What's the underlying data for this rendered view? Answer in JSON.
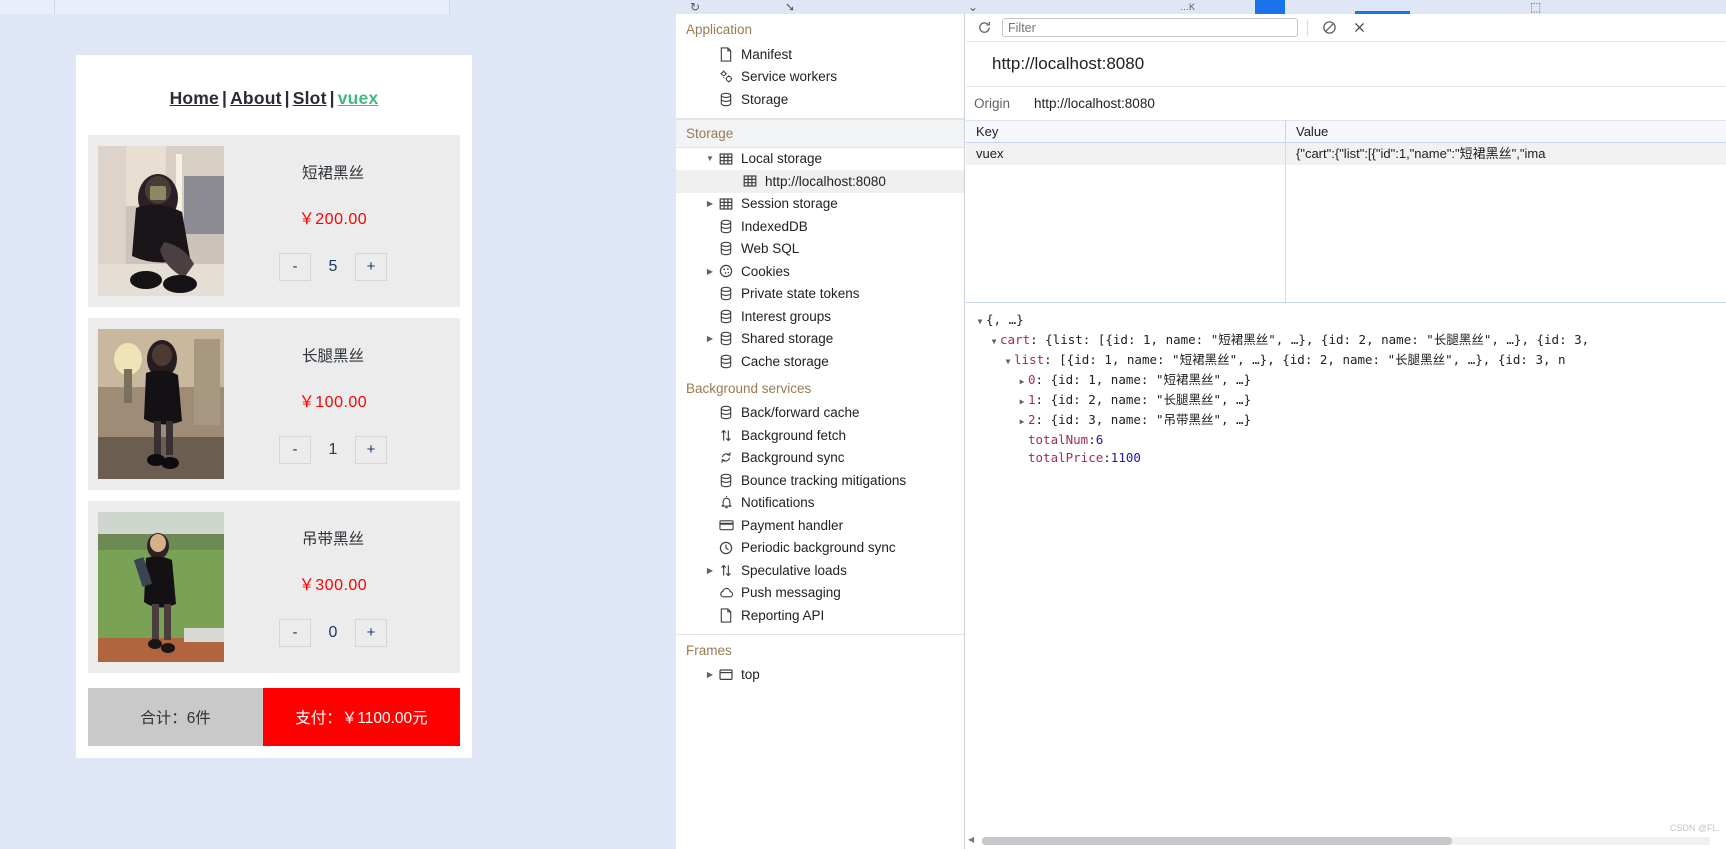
{
  "browser": {
    "chrome_icons": [
      "reload-icon",
      "cursor-icon",
      "chevron-down-icon",
      "puzzle-icon"
    ]
  },
  "app": {
    "nav": {
      "links": [
        {
          "label": "Home",
          "active": false
        },
        {
          "label": "About",
          "active": false
        },
        {
          "label": "Slot",
          "active": false
        },
        {
          "label": "vuex",
          "active": true
        }
      ],
      "separator": "|"
    },
    "cart": {
      "items": [
        {
          "id": 1,
          "name": "短裙黑丝",
          "price": "￥200.00",
          "qty": "5",
          "minus": "-",
          "plus": "+",
          "image": "woman-black-dress-mirror"
        },
        {
          "id": 2,
          "name": "长腿黑丝",
          "price": "￥100.00",
          "qty": "1",
          "minus": "-",
          "plus": "+",
          "image": "woman-black-dress-lamp"
        },
        {
          "id": 3,
          "name": "吊带黑丝",
          "price": "￥300.00",
          "qty": "0",
          "minus": "-",
          "plus": "+",
          "image": "woman-black-dress-grass"
        }
      ],
      "total_count_label": "合计：6件",
      "pay_label": "支付：￥1100.00元",
      "colors": {
        "price": "#ff0000",
        "pay_bg": "#ff0000",
        "total_bg": "#c9c9c9",
        "active_link": "#42b983"
      }
    }
  },
  "devtools": {
    "sidebar": {
      "sections": [
        {
          "title": "Application",
          "type": "group",
          "items": [
            {
              "label": "Manifest",
              "icon": "document-icon",
              "twisty": "none",
              "indent": 1
            },
            {
              "label": "Service workers",
              "icon": "gears-icon",
              "twisty": "none",
              "indent": 1
            },
            {
              "label": "Storage",
              "icon": "database-icon",
              "twisty": "none",
              "indent": 1
            }
          ]
        },
        {
          "title": "Storage",
          "type": "header",
          "items": [
            {
              "label": "Local storage",
              "icon": "table-icon",
              "twisty": "expanded",
              "indent": 1
            },
            {
              "label": "http://localhost:8080",
              "icon": "table-icon",
              "twisty": "none",
              "indent": 2,
              "selected": true
            },
            {
              "label": "Session storage",
              "icon": "table-icon",
              "twisty": "collapsed",
              "indent": 1
            },
            {
              "label": "IndexedDB",
              "icon": "database-icon",
              "twisty": "none",
              "indent": 1
            },
            {
              "label": "Web SQL",
              "icon": "database-icon",
              "twisty": "none",
              "indent": 1
            },
            {
              "label": "Cookies",
              "icon": "cookie-icon",
              "twisty": "collapsed",
              "indent": 1
            },
            {
              "label": "Private state tokens",
              "icon": "database-icon",
              "twisty": "none",
              "indent": 1
            },
            {
              "label": "Interest groups",
              "icon": "database-icon",
              "twisty": "none",
              "indent": 1
            },
            {
              "label": "Shared storage",
              "icon": "database-icon",
              "twisty": "collapsed",
              "indent": 1
            },
            {
              "label": "Cache storage",
              "icon": "database-icon",
              "twisty": "none",
              "indent": 1
            }
          ]
        },
        {
          "title": "Background services",
          "type": "group",
          "items": [
            {
              "label": "Back/forward cache",
              "icon": "database-icon",
              "twisty": "none",
              "indent": 1
            },
            {
              "label": "Background fetch",
              "icon": "arrows-updown-icon",
              "twisty": "none",
              "indent": 1
            },
            {
              "label": "Background sync",
              "icon": "sync-icon",
              "twisty": "none",
              "indent": 1
            },
            {
              "label": "Bounce tracking mitigations",
              "icon": "database-icon",
              "twisty": "none",
              "indent": 1
            },
            {
              "label": "Notifications",
              "icon": "bell-icon",
              "twisty": "none",
              "indent": 1
            },
            {
              "label": "Payment handler",
              "icon": "credit-card-icon",
              "twisty": "none",
              "indent": 1
            },
            {
              "label": "Periodic background sync",
              "icon": "clock-icon",
              "twisty": "none",
              "indent": 1
            },
            {
              "label": "Speculative loads",
              "icon": "arrows-updown-icon",
              "twisty": "collapsed",
              "indent": 1
            },
            {
              "label": "Push messaging",
              "icon": "cloud-icon",
              "twisty": "none",
              "indent": 1
            },
            {
              "label": "Reporting API",
              "icon": "document-icon",
              "twisty": "none",
              "indent": 1
            }
          ]
        },
        {
          "title": "Frames",
          "type": "group",
          "items": [
            {
              "label": "top",
              "icon": "frame-icon",
              "twisty": "collapsed",
              "indent": 1
            }
          ]
        }
      ]
    },
    "main": {
      "toolbar": {
        "refresh_icon": "refresh-icon",
        "filter_placeholder": "Filter",
        "filter_value": "",
        "clear_icon": "no-entry-icon",
        "close_icon": "close-icon"
      },
      "origin_title": "http://localhost:8080",
      "origin_label": "Origin",
      "origin_value": "http://localhost:8080",
      "table": {
        "columns": [
          "Key",
          "Value"
        ],
        "rows": [
          {
            "key": "vuex",
            "value": "{\"cart\":{\"list\":[{\"id\":1,\"name\":\"短裙黑丝\",\"ima"
          }
        ]
      },
      "json_preview": {
        "lines": [
          {
            "indent": 0,
            "twisty": "expanded",
            "text": "{, …}"
          },
          {
            "indent": 1,
            "twisty": "expanded",
            "key": "cart",
            "text": ": {list: [{id: 1, name: \"短裙黑丝\", …}, {id: 2, name: \"长腿黑丝\", …}, {id: 3,"
          },
          {
            "indent": 2,
            "twisty": "expanded",
            "key": "list",
            "text": ": [{id: 1, name: \"短裙黑丝\", …}, {id: 2, name: \"长腿黑丝\", …}, {id: 3, n"
          },
          {
            "indent": 3,
            "twisty": "collapsed",
            "key": "0",
            "text": ": {id: 1, name: \"短裙黑丝\", …}"
          },
          {
            "indent": 3,
            "twisty": "collapsed",
            "key": "1",
            "text": ": {id: 2, name: \"长腿黑丝\", …}"
          },
          {
            "indent": 3,
            "twisty": "collapsed",
            "key": "2",
            "text": ": {id: 3, name: \"吊带黑丝\", …}"
          },
          {
            "indent": 3,
            "twisty": "none",
            "key": "totalNum",
            "text": ": ",
            "num": "6"
          },
          {
            "indent": 3,
            "twisty": "none",
            "key": "totalPrice",
            "text": ": ",
            "num": "1100"
          }
        ]
      }
    }
  },
  "watermark": "CSDN @FL."
}
